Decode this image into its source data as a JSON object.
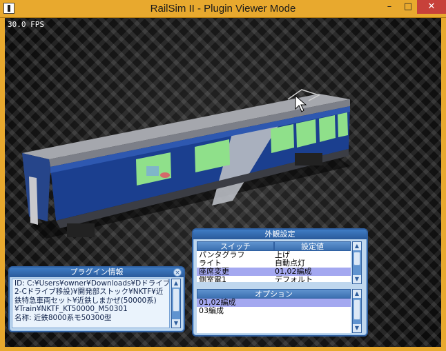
{
  "window": {
    "title": "RailSim II - Plugin Viewer Mode",
    "minimize": "–",
    "maximize": "□",
    "close": "✕"
  },
  "viewport": {
    "fps": "30.0 FPS"
  },
  "plugin_info": {
    "title": "プラグイン情報",
    "close_icon": "×",
    "lines": [
      "ID: C:¥Users¥owner¥Downloads¥Dドライブ(",
      "2-Cドライブ移設)¥開発部ストック¥NKTF¥近",
      "鉄特急車両セット¥近鉄しまかぜ(50000系)",
      "¥Train¥NKTF_KT50000_M50301",
      "名称: 近鉄8000系モ50300型"
    ]
  },
  "appearance": {
    "title": "外観設定",
    "col_switch": "スイッチ",
    "col_value": "設定値",
    "rows": [
      {
        "switch": "パンタグラフ",
        "value": "上げ"
      },
      {
        "switch": "ライト",
        "value": "自動点灯"
      },
      {
        "switch": "座席変更",
        "value": "01,02編成"
      },
      {
        "switch": "側室電1",
        "value": "デフォルト"
      }
    ],
    "options_title": "オプション",
    "options": [
      "01,02編成",
      "03編成"
    ]
  },
  "colors": {
    "titlebar": "#e8a92e",
    "train_body": "#1b3f8f",
    "train_roof": "#9a9aa2",
    "window_green": "#8fe08a",
    "selection": "#a4a8f0"
  }
}
